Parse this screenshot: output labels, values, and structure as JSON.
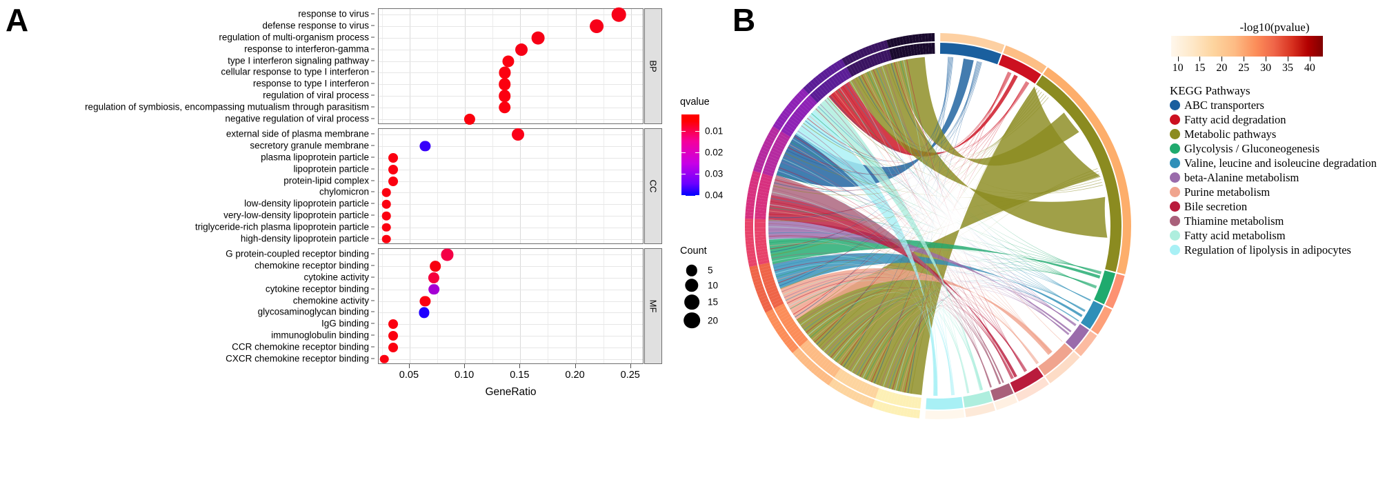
{
  "figure": {
    "panel_a_letter": "A",
    "panel_b_letter": "B"
  },
  "chart_data": [
    {
      "type": "scatter",
      "id": "go-enrichment-dotplot",
      "title": "",
      "xlabel": "GeneRatio",
      "ylabel": "",
      "xlim": [
        0.022,
        0.262
      ],
      "xticks": [
        0.05,
        0.1,
        0.15,
        0.2,
        0.25
      ],
      "xtick_labels": [
        "0.05",
        "0.10",
        "0.15",
        "0.20",
        "0.25"
      ],
      "grid": true,
      "legend_position": "right",
      "color_legend": {
        "title": "qvalue",
        "ticks": [
          0.01,
          0.02,
          0.03,
          0.04
        ],
        "tick_labels": [
          "0.01",
          "0.02",
          "0.03",
          "0.04"
        ],
        "low_color": "#ff0000",
        "high_color": "#0000ff"
      },
      "size_legend": {
        "title": "Count",
        "values": [
          5,
          10,
          15,
          20
        ],
        "labels": [
          "5",
          "10",
          "15",
          "20"
        ],
        "color": "#000000"
      },
      "facets": [
        {
          "label": "BP",
          "points": [
            {
              "term": "response to virus",
              "generatio": 0.239,
              "count": 21,
              "qvalue": 0.003,
              "color": "#f70018"
            },
            {
              "term": "defense response to virus",
              "generatio": 0.219,
              "count": 19,
              "qvalue": 0.003,
              "color": "#f70018"
            },
            {
              "term": "regulation of multi-organism process",
              "generatio": 0.166,
              "count": 16,
              "qvalue": 0.004,
              "color": "#f60016"
            },
            {
              "term": "response to interferon-gamma",
              "generatio": 0.151,
              "count": 14,
              "qvalue": 0.004,
              "color": "#f60016"
            },
            {
              "term": "type I interferon signaling pathway",
              "generatio": 0.139,
              "count": 12,
              "qvalue": 0.004,
              "color": "#fb0010"
            },
            {
              "term": "cellular response to type I interferon",
              "generatio": 0.136,
              "count": 12,
              "qvalue": 0.004,
              "color": "#fb0010"
            },
            {
              "term": "response to type I interferon",
              "generatio": 0.136,
              "count": 13,
              "qvalue": 0.004,
              "color": "#fb0010"
            },
            {
              "term": "regulation of viral process",
              "generatio": 0.136,
              "count": 13,
              "qvalue": 0.004,
              "color": "#fb0010"
            },
            {
              "term": "regulation of symbiosis, encompassing mutualism through parasitism",
              "generatio": 0.136,
              "count": 13,
              "qvalue": 0.004,
              "color": "#fb0010"
            },
            {
              "term": "negative regulation of viral process",
              "generatio": 0.104,
              "count": 10,
              "qvalue": 0.005,
              "color": "#fa000d"
            }
          ]
        },
        {
          "label": "CC",
          "points": [
            {
              "term": "external side of plasma membrane",
              "generatio": 0.148,
              "count": 14,
              "qvalue": 0.004,
              "color": "#fb0018"
            },
            {
              "term": "secretory granule membrane",
              "generatio": 0.064,
              "count": 8,
              "qvalue": 0.04,
              "color": "#3700fa"
            },
            {
              "term": "plasma lipoprotein particle",
              "generatio": 0.035,
              "count": 6,
              "qvalue": 0.003,
              "color": "#fb0010"
            },
            {
              "term": "lipoprotein particle",
              "generatio": 0.035,
              "count": 6,
              "qvalue": 0.003,
              "color": "#fb0010"
            },
            {
              "term": "protein-lipid complex",
              "generatio": 0.035,
              "count": 6,
              "qvalue": 0.003,
              "color": "#fb0010"
            },
            {
              "term": "chylomicron",
              "generatio": 0.029,
              "count": 4,
              "qvalue": 0.003,
              "color": "#fb0010"
            },
            {
              "term": "low-density lipoprotein particle",
              "generatio": 0.029,
              "count": 4,
              "qvalue": 0.003,
              "color": "#fb0010"
            },
            {
              "term": "very-low-density lipoprotein particle",
              "generatio": 0.029,
              "count": 4,
              "qvalue": 0.003,
              "color": "#fb0010"
            },
            {
              "term": "triglyceride-rich plasma lipoprotein particle",
              "generatio": 0.029,
              "count": 4,
              "qvalue": 0.003,
              "color": "#fb0010"
            },
            {
              "term": "high-density lipoprotein particle",
              "generatio": 0.029,
              "count": 4,
              "qvalue": 0.003,
              "color": "#fb0010"
            }
          ]
        },
        {
          "label": "MF",
          "points": [
            {
              "term": "G protein-coupled receptor binding",
              "generatio": 0.084,
              "count": 12,
              "qvalue": 0.012,
              "color": "#f40046"
            },
            {
              "term": "chemokine receptor binding",
              "generatio": 0.073,
              "count": 9,
              "qvalue": 0.004,
              "color": "#f8000f"
            },
            {
              "term": "cytokine activity",
              "generatio": 0.072,
              "count": 10,
              "qvalue": 0.011,
              "color": "#f5003c"
            },
            {
              "term": "cytokine receptor binding",
              "generatio": 0.072,
              "count": 9,
              "qvalue": 0.026,
              "color": "#a400d4"
            },
            {
              "term": "chemokine activity",
              "generatio": 0.064,
              "count": 8,
              "qvalue": 0.004,
              "color": "#fb0010"
            },
            {
              "term": "glycosaminoglycan binding",
              "generatio": 0.063,
              "count": 8,
              "qvalue": 0.04,
              "color": "#2000ff"
            },
            {
              "term": "IgG binding",
              "generatio": 0.035,
              "count": 6,
              "qvalue": 0.004,
              "color": "#fb0010"
            },
            {
              "term": "immunoglobulin binding",
              "generatio": 0.035,
              "count": 6,
              "qvalue": 0.004,
              "color": "#fb0010"
            },
            {
              "term": "CCR chemokine receptor binding",
              "generatio": 0.035,
              "count": 6,
              "qvalue": 0.004,
              "color": "#fb0010"
            },
            {
              "term": "CXCR chemokine receptor binding",
              "generatio": 0.027,
              "count": 4,
              "qvalue": 0.004,
              "color": "#fb0010"
            }
          ]
        }
      ]
    },
    {
      "type": "chord",
      "id": "kegg-chord-diagram",
      "title": "",
      "color_legend": {
        "title": "-log10(pvalue)",
        "ticks": [
          10,
          15,
          20,
          25,
          30,
          35,
          40
        ],
        "tick_labels": [
          "10",
          "15",
          "20",
          "25",
          "30",
          "35",
          "40"
        ],
        "low_color": "#fff7ec",
        "high_color": "#7f0000"
      },
      "legend_title": "KEGG Pathways",
      "categories": [
        {
          "label": "ABC transporters",
          "color": "#1a5f9e",
          "share": 0.085
        },
        {
          "label": "Fatty acid degradation",
          "color": "#cc1020",
          "share": 0.06
        },
        {
          "label": "Metabolic pathways",
          "color": "#8b8b20",
          "share": 0.3
        },
        {
          "label": "Glycolysis / Gluconeogenesis",
          "color": "#1faa6e",
          "share": 0.046
        },
        {
          "label": "Valine, leucine and isoleucine degradation",
          "color": "#2f8fb8",
          "share": 0.038
        },
        {
          "label": "beta-Alanine metabolism",
          "color": "#9a6bab",
          "share": 0.035
        },
        {
          "label": "Purine metabolism",
          "color": "#f0a48e",
          "share": 0.052
        },
        {
          "label": "Bile secretion",
          "color": "#b91b3c",
          "share": 0.046
        },
        {
          "label": "Thiamine metabolism",
          "color": "#a9607a",
          "share": 0.03
        },
        {
          "label": "Fatty acid metabolism",
          "color": "#aeeede",
          "share": 0.04
        },
        {
          "label": "Regulation of lipolysis in adipocytes",
          "color": "#a8f0f5",
          "share": 0.052
        }
      ],
      "gene_sector_colors": [
        "#fdf0b5",
        "#fdd49e",
        "#fdbb84",
        "#fc8d59",
        "#ef6548",
        "#e8436a",
        "#d7307f",
        "#b52aa0",
        "#8e22b5",
        "#5b1d96",
        "#3a1461",
        "#1a0a2e"
      ]
    }
  ]
}
